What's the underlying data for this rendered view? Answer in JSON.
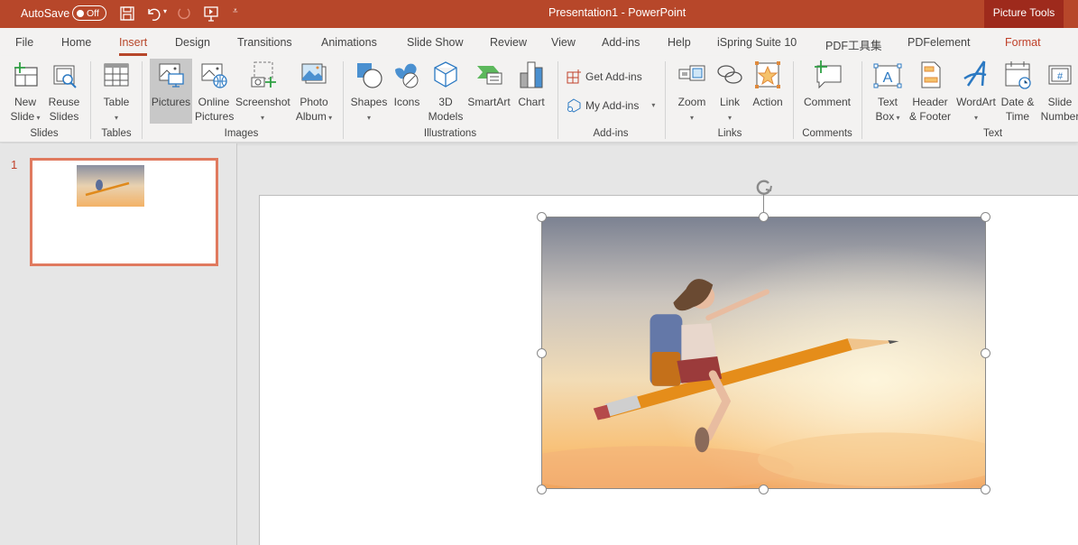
{
  "titlebar": {
    "autosave_label": "AutoSave",
    "autosave_state": "Off",
    "title": "Presentation1  -  PowerPoint",
    "contextual_group": "Picture Tools",
    "quick_access": [
      "save-icon",
      "undo-icon",
      "redo-icon",
      "present-icon",
      "customize-icon"
    ],
    "brand_color": "#b7472a"
  },
  "tabs": [
    {
      "label": "File"
    },
    {
      "label": "Home"
    },
    {
      "label": "Insert",
      "active": true
    },
    {
      "label": "Design"
    },
    {
      "label": "Transitions"
    },
    {
      "label": "Animations"
    },
    {
      "label": "Slide Show"
    },
    {
      "label": "Review"
    },
    {
      "label": "View"
    },
    {
      "label": "Add-ins"
    },
    {
      "label": "Help"
    },
    {
      "label": "iSpring Suite 10"
    },
    {
      "label": "PDF工具集"
    },
    {
      "label": "PDFelement"
    },
    {
      "label": "Format",
      "contextual": true
    }
  ],
  "ribbon": {
    "groups": {
      "slides": "Slides",
      "tables": "Tables",
      "images": "Images",
      "illustrations": "Illustrations",
      "addins": "Add-ins",
      "links": "Links",
      "comments": "Comments",
      "text": "Text"
    },
    "buttons": {
      "new_slide": [
        "New",
        "Slide"
      ],
      "reuse_slides": [
        "Reuse",
        "Slides"
      ],
      "table": [
        "Table",
        ""
      ],
      "pictures": [
        "Pictures",
        ""
      ],
      "online_pictures": [
        "Online",
        "Pictures"
      ],
      "screenshot": [
        "Screenshot",
        ""
      ],
      "photo_album": [
        "Photo",
        "Album"
      ],
      "shapes": [
        "Shapes",
        ""
      ],
      "icons": [
        "Icons",
        ""
      ],
      "models3d": [
        "3D",
        "Models"
      ],
      "smartart": [
        "SmartArt",
        ""
      ],
      "chart": [
        "Chart",
        ""
      ],
      "get_addins": "Get Add-ins",
      "my_addins": "My Add-ins",
      "zoom": [
        "Zoom",
        ""
      ],
      "link": [
        "Link",
        ""
      ],
      "action": [
        "Action",
        ""
      ],
      "comment": [
        "Comment",
        ""
      ],
      "text_box": [
        "Text",
        "Box"
      ],
      "header_footer": [
        "Header",
        "& Footer"
      ],
      "wordart": [
        "WordArt",
        ""
      ],
      "date_time": [
        "Date &",
        "Time"
      ],
      "slide_number": [
        "Slide",
        "Number"
      ]
    },
    "selected": "Pictures"
  },
  "slides_pane": {
    "slides": [
      {
        "number": "1",
        "selected": true
      }
    ]
  },
  "editor": {
    "selected_object": "picture",
    "picture_description": "Girl with backpack riding a flying pencil in a sunset sky"
  }
}
